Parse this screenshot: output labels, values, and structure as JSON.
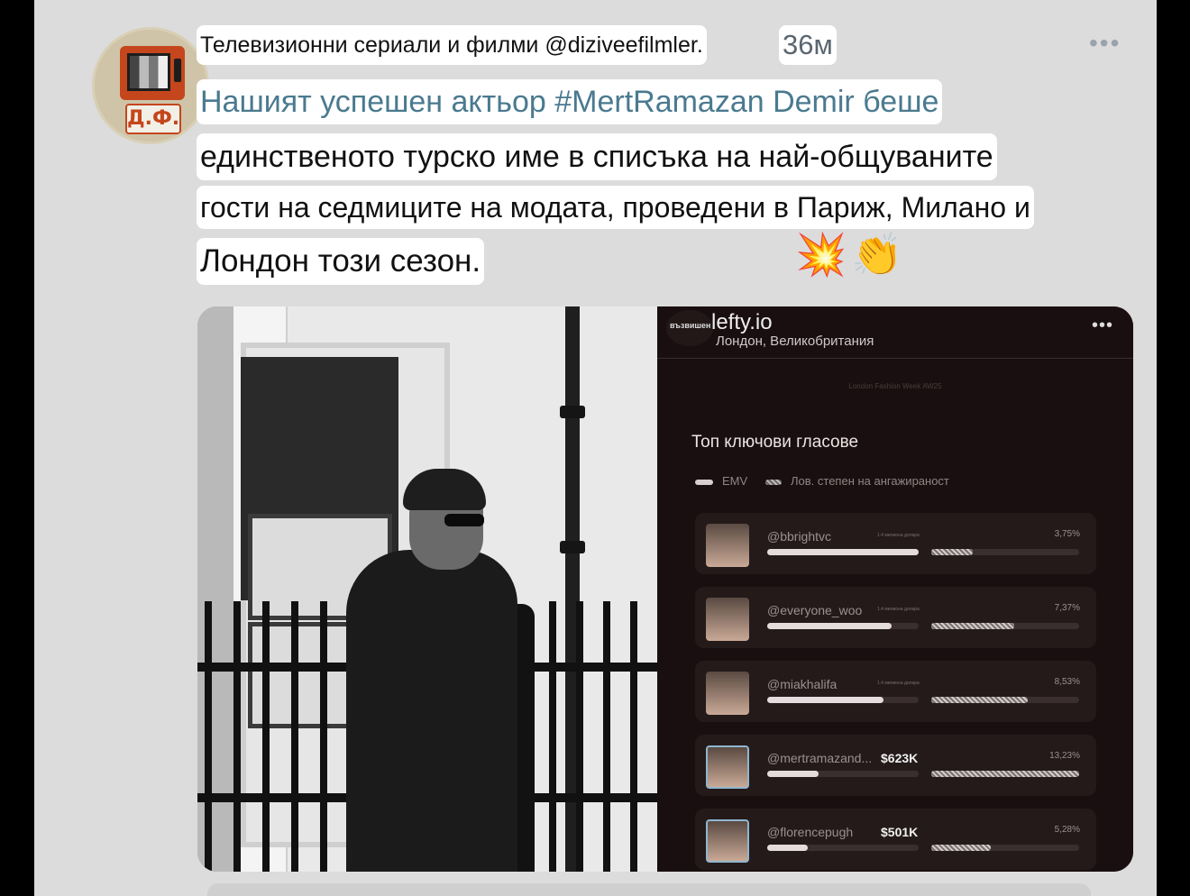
{
  "post": {
    "author": "Телевизионни сериали и филми @diziveefilmler.",
    "time": "36м",
    "more": "•••",
    "avatar_logo": "Д.Ф.",
    "text_line1": "Нашият успешен актьор #MertRamazan Demir беше",
    "text_line2": "единственото турско име в списъка на най-общуваните",
    "text_line3": "гости на седмиците на модата, проведени в Париж, Милано и",
    "text_line4": "Лондон този сезон.",
    "emoji1": "💥",
    "emoji2": "👏"
  },
  "panel": {
    "badge": "възвишен",
    "handle": "lefty.io",
    "location": "Лондон, Великобритания",
    "more": "•••",
    "subtitle": "London Fashion Week AW25",
    "title": "Топ ключови гласове",
    "legend_emv": "EMV",
    "legend_engagement": "Лов. степен на ангажираност",
    "rows": [
      {
        "handle": "@bbrightvc",
        "emv": "",
        "tiny": "1.4 милиона долара",
        "pct": "3,75%",
        "emv_fill": 1.0,
        "eng_fill": 0.28
      },
      {
        "handle": "@everyone_woo",
        "emv": "",
        "tiny": "1.4 милиона долара",
        "pct": "7,37%",
        "emv_fill": 0.82,
        "eng_fill": 0.56
      },
      {
        "handle": "@miakhalifa",
        "emv": "",
        "tiny": "1.4 милиона долара",
        "pct": "8,53%",
        "emv_fill": 0.77,
        "eng_fill": 0.65
      },
      {
        "handle": "@mertramazand...",
        "emv": "$623K",
        "tiny": "",
        "pct": "13,23%",
        "emv_fill": 0.34,
        "eng_fill": 1.0
      },
      {
        "handle": "@florencepugh",
        "emv": "$501K",
        "tiny": "",
        "pct": "5,28%",
        "emv_fill": 0.27,
        "eng_fill": 0.4
      }
    ]
  },
  "colors": {
    "card_bg": "#dcdcdc",
    "link_teal": "#4a7a8f",
    "panel_bg": "#1a0f10"
  }
}
